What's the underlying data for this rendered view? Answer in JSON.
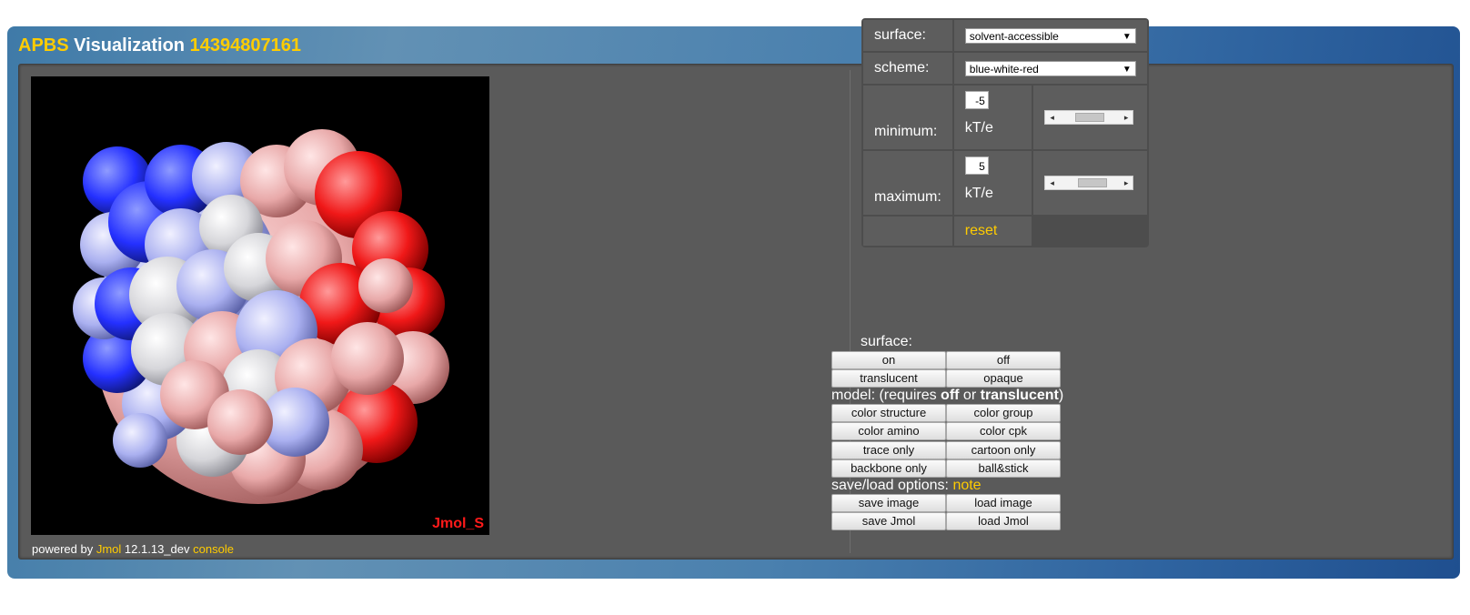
{
  "header": {
    "title_prefix": "APBS",
    "title_main": "Visualization",
    "job_id": "14394807161"
  },
  "viewer": {
    "label": "Jmol_S",
    "powered_by": "powered by",
    "jmol_link": "Jmol",
    "version": "12.1.13_dev",
    "console_link": "console"
  },
  "controls": {
    "surface_label": "surface:",
    "surface_value": "solvent-accessible",
    "scheme_label": "scheme:",
    "scheme_value": "blue-white-red",
    "minimum_label": "minimum:",
    "minimum_value": "-5",
    "minimum_unit": "kT/e",
    "minimum_slider_fraction": 0.33,
    "maximum_label": "maximum:",
    "maximum_value": "5",
    "maximum_unit": "kT/e",
    "maximum_slider_fraction": 0.37,
    "reset_label": "reset"
  },
  "surface_section": {
    "heading": "surface:",
    "buttons": [
      "on",
      "off",
      "translucent",
      "opaque"
    ]
  },
  "model_section": {
    "heading_prefix": "model: (requires ",
    "bold1": "off",
    "mid": " or ",
    "bold2": "translucent",
    "heading_suffix": ")",
    "buttons": [
      "color structure",
      "color group",
      "color amino",
      "color cpk",
      "trace only",
      "cartoon only",
      "backbone only",
      "ball&stick"
    ]
  },
  "saveload_section": {
    "heading": "save/load options:",
    "note": "note",
    "buttons": [
      "save image",
      "load image",
      "save Jmol",
      "load Jmol"
    ]
  },
  "colors": {
    "accent": "#ffcc00",
    "panel": "#5a5a5a",
    "positive": "#ff0000",
    "negative": "#2233ff"
  }
}
